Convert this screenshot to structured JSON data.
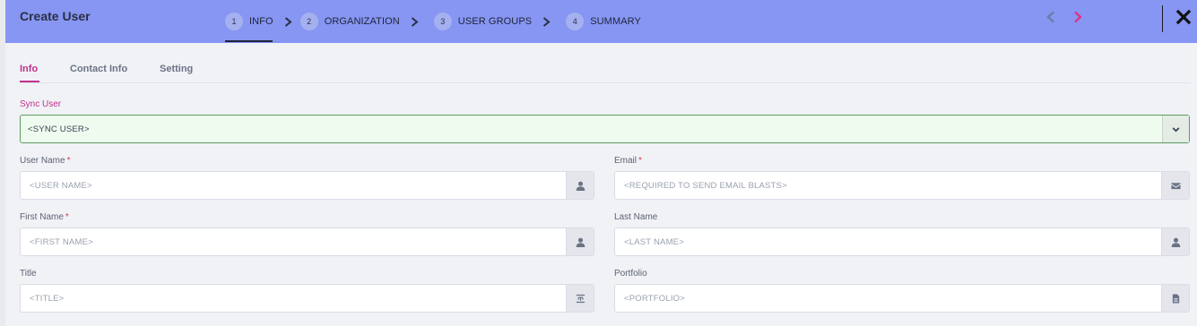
{
  "header": {
    "title": "Create User",
    "steps": [
      {
        "num": "1",
        "label": "INFO",
        "active": true
      },
      {
        "num": "2",
        "label": "ORGANIZATION",
        "active": false
      },
      {
        "num": "3",
        "label": "USER GROUPS",
        "active": false
      },
      {
        "num": "4",
        "label": "SUMMARY",
        "active": false
      }
    ],
    "icons": {
      "prev": "chevron-left-icon",
      "next": "chevron-right-icon",
      "close": "close-icon"
    },
    "colors": {
      "bar": "#8696f2",
      "next_accent": "#e0318a",
      "prev_disabled": "#6e7aa8"
    }
  },
  "tabs": [
    {
      "label": "Info",
      "active": true
    },
    {
      "label": "Contact Info",
      "active": false
    },
    {
      "label": "Setting",
      "active": false
    }
  ],
  "form": {
    "sync_user": {
      "label": "Sync User",
      "value": "<SYNC USER>",
      "icon": "chevron-down-icon"
    },
    "user_name": {
      "label": "User Name",
      "required": "*",
      "placeholder": "<USER NAME>",
      "icon": "user-icon"
    },
    "email": {
      "label": "Email",
      "required": "*",
      "placeholder": "<REQUIRED TO SEND EMAIL BLASTS>",
      "icon": "envelope-icon"
    },
    "first_name": {
      "label": "First Name",
      "required": "*",
      "placeholder": "<FIRST NAME>",
      "icon": "user-icon"
    },
    "last_name": {
      "label": "Last Name",
      "placeholder": "<LAST NAME>",
      "icon": "user-icon"
    },
    "title": {
      "label": "Title",
      "placeholder": "<TITLE>",
      "icon": "text-height-icon"
    },
    "portfolio": {
      "label": "Portfolio",
      "placeholder": "<PORTFOLIO>",
      "icon": "file-icon"
    }
  }
}
